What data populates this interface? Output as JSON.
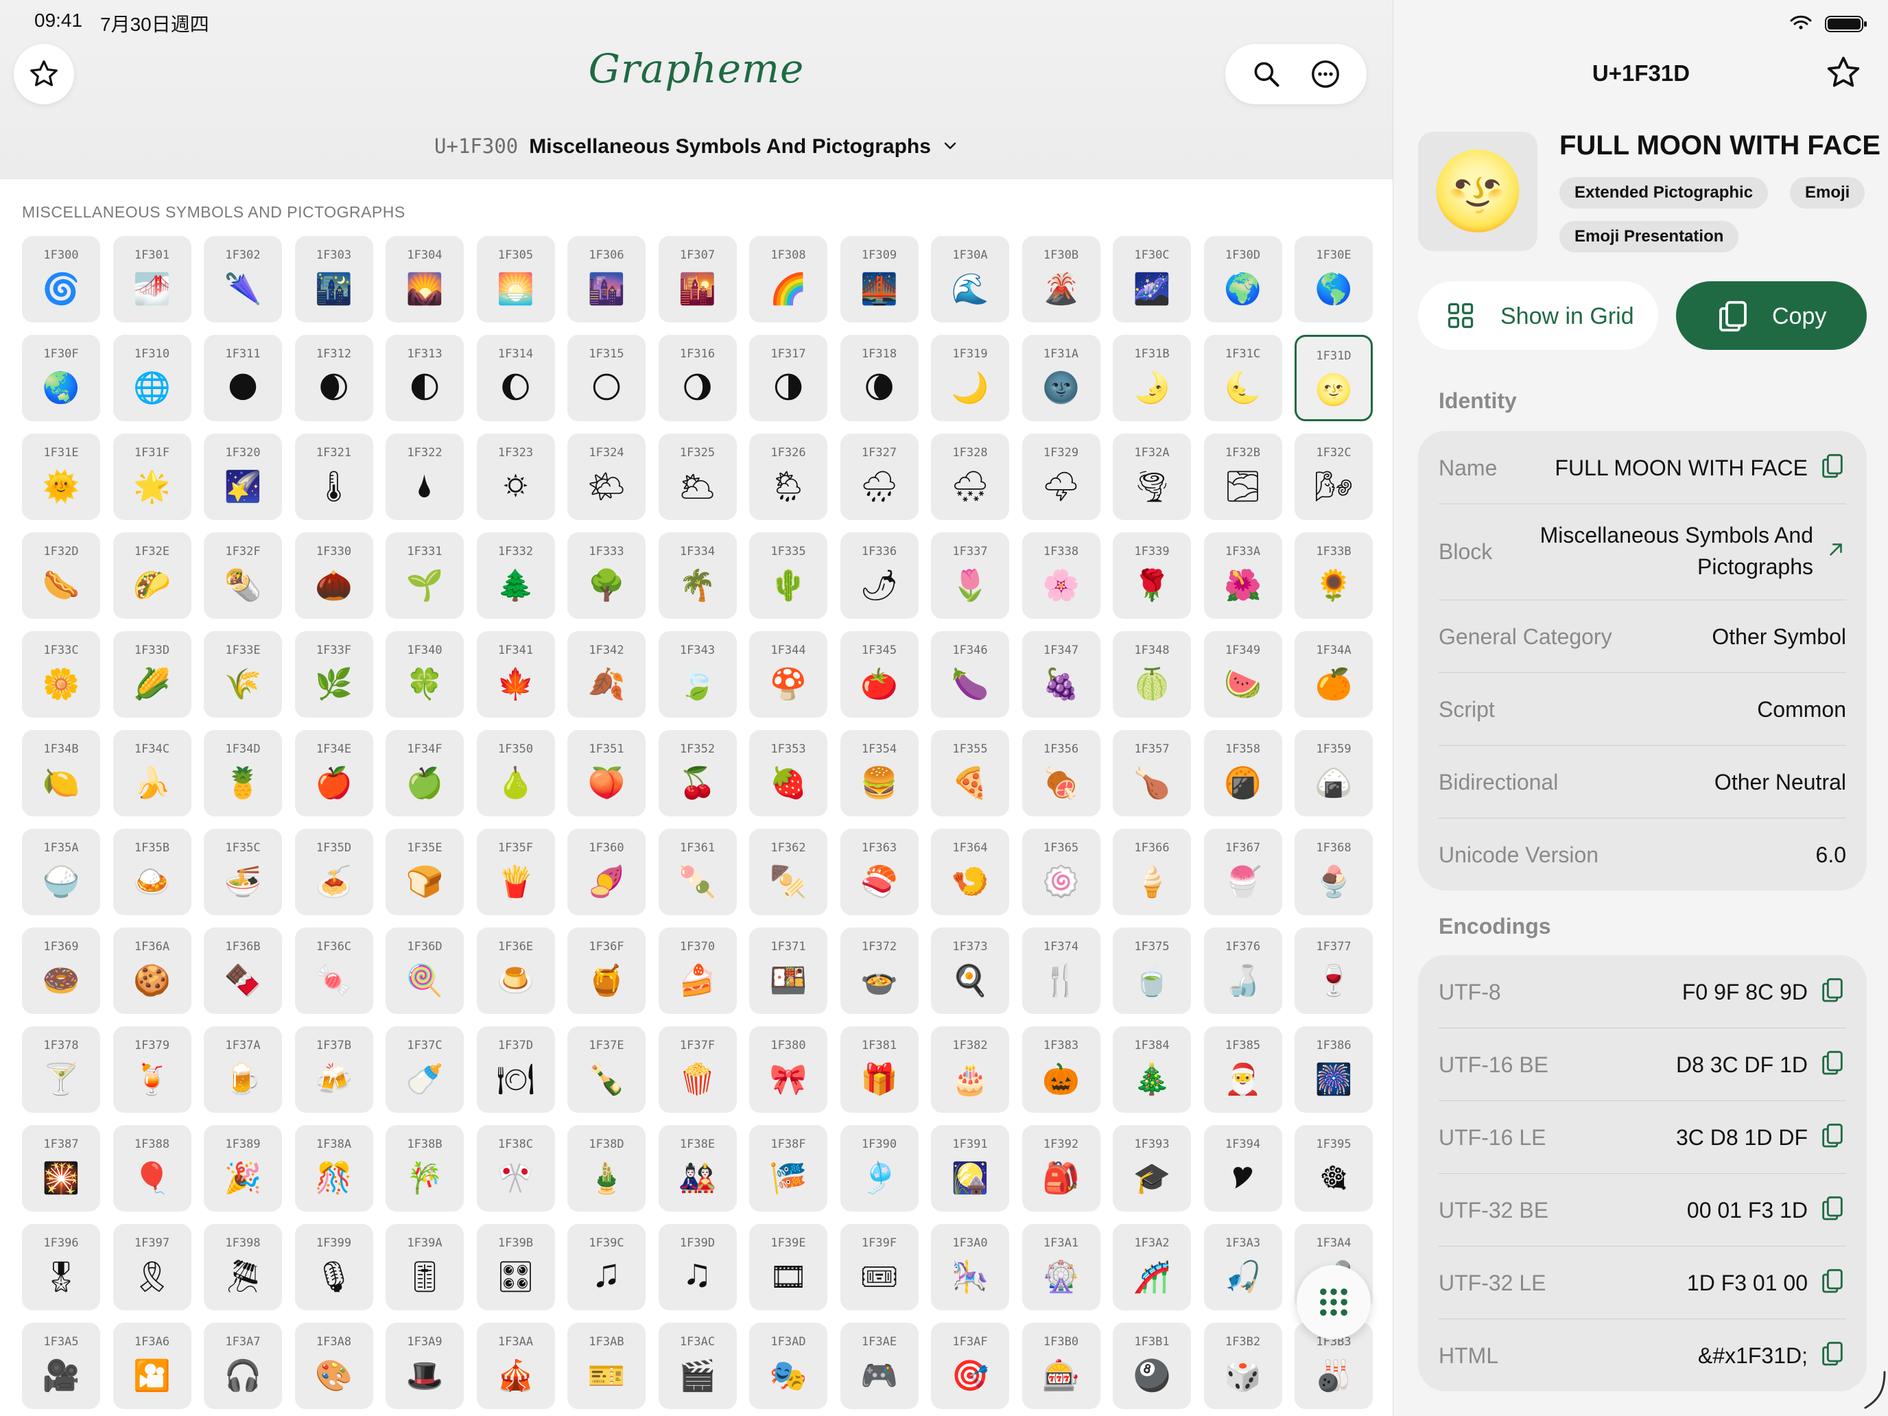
{
  "status": {
    "time": "09:41",
    "date": "7月30日週四"
  },
  "app": {
    "title": "Grapheme"
  },
  "block_picker": {
    "code": "U+1F300",
    "name": "Miscellaneous Symbols And Pictographs"
  },
  "section_header": "MISCELLANEOUS SYMBOLS AND PICTOGRAPHS",
  "grid_cells": [
    {
      "cp": "1F300",
      "g": "🌀"
    },
    {
      "cp": "1F301",
      "g": "🌁"
    },
    {
      "cp": "1F302",
      "g": "🌂"
    },
    {
      "cp": "1F303",
      "g": "🌃"
    },
    {
      "cp": "1F304",
      "g": "🌄"
    },
    {
      "cp": "1F305",
      "g": "🌅"
    },
    {
      "cp": "1F306",
      "g": "🌆"
    },
    {
      "cp": "1F307",
      "g": "🌇"
    },
    {
      "cp": "1F308",
      "g": "🌈"
    },
    {
      "cp": "1F309",
      "g": "🌉"
    },
    {
      "cp": "1F30A",
      "g": "🌊"
    },
    {
      "cp": "1F30B",
      "g": "🌋"
    },
    {
      "cp": "1F30C",
      "g": "🌌"
    },
    {
      "cp": "1F30D",
      "g": "🌍"
    },
    {
      "cp": "1F30E",
      "g": "🌎"
    },
    {
      "cp": "1F30F",
      "g": "🌏"
    },
    {
      "cp": "1F310",
      "g": "🌐"
    },
    {
      "cp": "1F311",
      "g": "🌑"
    },
    {
      "cp": "1F312",
      "g": "🌒"
    },
    {
      "cp": "1F313",
      "g": "🌓"
    },
    {
      "cp": "1F314",
      "g": "🌔"
    },
    {
      "cp": "1F315",
      "g": "🌕"
    },
    {
      "cp": "1F316",
      "g": "🌖"
    },
    {
      "cp": "1F317",
      "g": "🌗"
    },
    {
      "cp": "1F318",
      "g": "🌘"
    },
    {
      "cp": "1F319",
      "g": "🌙"
    },
    {
      "cp": "1F31A",
      "g": "🌚"
    },
    {
      "cp": "1F31B",
      "g": "🌛"
    },
    {
      "cp": "1F31C",
      "g": "🌜"
    },
    {
      "cp": "1F31D",
      "g": "🌝",
      "selected": true
    },
    {
      "cp": "1F31E",
      "g": "🌞"
    },
    {
      "cp": "1F31F",
      "g": "🌟"
    },
    {
      "cp": "1F320",
      "g": "🌠"
    },
    {
      "cp": "1F321",
      "g": "🌡"
    },
    {
      "cp": "1F322",
      "g": "🌢"
    },
    {
      "cp": "1F323",
      "g": "🌣"
    },
    {
      "cp": "1F324",
      "g": "🌤"
    },
    {
      "cp": "1F325",
      "g": "🌥"
    },
    {
      "cp": "1F326",
      "g": "🌦"
    },
    {
      "cp": "1F327",
      "g": "🌧"
    },
    {
      "cp": "1F328",
      "g": "🌨"
    },
    {
      "cp": "1F329",
      "g": "🌩"
    },
    {
      "cp": "1F32A",
      "g": "🌪"
    },
    {
      "cp": "1F32B",
      "g": "🌫"
    },
    {
      "cp": "1F32C",
      "g": "🌬"
    },
    {
      "cp": "1F32D",
      "g": "🌭"
    },
    {
      "cp": "1F32E",
      "g": "🌮"
    },
    {
      "cp": "1F32F",
      "g": "🌯"
    },
    {
      "cp": "1F330",
      "g": "🌰"
    },
    {
      "cp": "1F331",
      "g": "🌱"
    },
    {
      "cp": "1F332",
      "g": "🌲"
    },
    {
      "cp": "1F333",
      "g": "🌳"
    },
    {
      "cp": "1F334",
      "g": "🌴"
    },
    {
      "cp": "1F335",
      "g": "🌵"
    },
    {
      "cp": "1F336",
      "g": "🌶"
    },
    {
      "cp": "1F337",
      "g": "🌷"
    },
    {
      "cp": "1F338",
      "g": "🌸"
    },
    {
      "cp": "1F339",
      "g": "🌹"
    },
    {
      "cp": "1F33A",
      "g": "🌺"
    },
    {
      "cp": "1F33B",
      "g": "🌻"
    },
    {
      "cp": "1F33C",
      "g": "🌼"
    },
    {
      "cp": "1F33D",
      "g": "🌽"
    },
    {
      "cp": "1F33E",
      "g": "🌾"
    },
    {
      "cp": "1F33F",
      "g": "🌿"
    },
    {
      "cp": "1F340",
      "g": "🍀"
    },
    {
      "cp": "1F341",
      "g": "🍁"
    },
    {
      "cp": "1F342",
      "g": "🍂"
    },
    {
      "cp": "1F343",
      "g": "🍃"
    },
    {
      "cp": "1F344",
      "g": "🍄"
    },
    {
      "cp": "1F345",
      "g": "🍅"
    },
    {
      "cp": "1F346",
      "g": "🍆"
    },
    {
      "cp": "1F347",
      "g": "🍇"
    },
    {
      "cp": "1F348",
      "g": "🍈"
    },
    {
      "cp": "1F349",
      "g": "🍉"
    },
    {
      "cp": "1F34A",
      "g": "🍊"
    },
    {
      "cp": "1F34B",
      "g": "🍋"
    },
    {
      "cp": "1F34C",
      "g": "🍌"
    },
    {
      "cp": "1F34D",
      "g": "🍍"
    },
    {
      "cp": "1F34E",
      "g": "🍎"
    },
    {
      "cp": "1F34F",
      "g": "🍏"
    },
    {
      "cp": "1F350",
      "g": "🍐"
    },
    {
      "cp": "1F351",
      "g": "🍑"
    },
    {
      "cp": "1F352",
      "g": "🍒"
    },
    {
      "cp": "1F353",
      "g": "🍓"
    },
    {
      "cp": "1F354",
      "g": "🍔"
    },
    {
      "cp": "1F355",
      "g": "🍕"
    },
    {
      "cp": "1F356",
      "g": "🍖"
    },
    {
      "cp": "1F357",
      "g": "🍗"
    },
    {
      "cp": "1F358",
      "g": "🍘"
    },
    {
      "cp": "1F359",
      "g": "🍙"
    },
    {
      "cp": "1F35A",
      "g": "🍚"
    },
    {
      "cp": "1F35B",
      "g": "🍛"
    },
    {
      "cp": "1F35C",
      "g": "🍜"
    },
    {
      "cp": "1F35D",
      "g": "🍝"
    },
    {
      "cp": "1F35E",
      "g": "🍞"
    },
    {
      "cp": "1F35F",
      "g": "🍟"
    },
    {
      "cp": "1F360",
      "g": "🍠"
    },
    {
      "cp": "1F361",
      "g": "🍡"
    },
    {
      "cp": "1F362",
      "g": "🍢"
    },
    {
      "cp": "1F363",
      "g": "🍣"
    },
    {
      "cp": "1F364",
      "g": "🍤"
    },
    {
      "cp": "1F365",
      "g": "🍥"
    },
    {
      "cp": "1F366",
      "g": "🍦"
    },
    {
      "cp": "1F367",
      "g": "🍧"
    },
    {
      "cp": "1F368",
      "g": "🍨"
    },
    {
      "cp": "1F369",
      "g": "🍩"
    },
    {
      "cp": "1F36A",
      "g": "🍪"
    },
    {
      "cp": "1F36B",
      "g": "🍫"
    },
    {
      "cp": "1F36C",
      "g": "🍬"
    },
    {
      "cp": "1F36D",
      "g": "🍭"
    },
    {
      "cp": "1F36E",
      "g": "🍮"
    },
    {
      "cp": "1F36F",
      "g": "🍯"
    },
    {
      "cp": "1F370",
      "g": "🍰"
    },
    {
      "cp": "1F371",
      "g": "🍱"
    },
    {
      "cp": "1F372",
      "g": "🍲"
    },
    {
      "cp": "1F373",
      "g": "🍳"
    },
    {
      "cp": "1F374",
      "g": "🍴"
    },
    {
      "cp": "1F375",
      "g": "🍵"
    },
    {
      "cp": "1F376",
      "g": "🍶"
    },
    {
      "cp": "1F377",
      "g": "🍷"
    },
    {
      "cp": "1F378",
      "g": "🍸"
    },
    {
      "cp": "1F379",
      "g": "🍹"
    },
    {
      "cp": "1F37A",
      "g": "🍺"
    },
    {
      "cp": "1F37B",
      "g": "🍻"
    },
    {
      "cp": "1F37C",
      "g": "🍼"
    },
    {
      "cp": "1F37D",
      "g": "🍽"
    },
    {
      "cp": "1F37E",
      "g": "🍾"
    },
    {
      "cp": "1F37F",
      "g": "🍿"
    },
    {
      "cp": "1F380",
      "g": "🎀"
    },
    {
      "cp": "1F381",
      "g": "🎁"
    },
    {
      "cp": "1F382",
      "g": "🎂"
    },
    {
      "cp": "1F383",
      "g": "🎃"
    },
    {
      "cp": "1F384",
      "g": "🎄"
    },
    {
      "cp": "1F385",
      "g": "🎅"
    },
    {
      "cp": "1F386",
      "g": "🎆"
    },
    {
      "cp": "1F387",
      "g": "🎇"
    },
    {
      "cp": "1F388",
      "g": "🎈"
    },
    {
      "cp": "1F389",
      "g": "🎉"
    },
    {
      "cp": "1F38A",
      "g": "🎊"
    },
    {
      "cp": "1F38B",
      "g": "🎋"
    },
    {
      "cp": "1F38C",
      "g": "🎌"
    },
    {
      "cp": "1F38D",
      "g": "🎍"
    },
    {
      "cp": "1F38E",
      "g": "🎎"
    },
    {
      "cp": "1F38F",
      "g": "🎏"
    },
    {
      "cp": "1F390",
      "g": "🎐"
    },
    {
      "cp": "1F391",
      "g": "🎑"
    },
    {
      "cp": "1F392",
      "g": "🎒"
    },
    {
      "cp": "1F393",
      "g": "🎓"
    },
    {
      "cp": "1F394",
      "g": "🎔"
    },
    {
      "cp": "1F395",
      "g": "🎕"
    },
    {
      "cp": "1F396",
      "g": "🎖"
    },
    {
      "cp": "1F397",
      "g": "🎗"
    },
    {
      "cp": "1F398",
      "g": "🎘"
    },
    {
      "cp": "1F399",
      "g": "🎙"
    },
    {
      "cp": "1F39A",
      "g": "🎚"
    },
    {
      "cp": "1F39B",
      "g": "🎛"
    },
    {
      "cp": "1F39C",
      "g": "🎜"
    },
    {
      "cp": "1F39D",
      "g": "🎝"
    },
    {
      "cp": "1F39E",
      "g": "🎞"
    },
    {
      "cp": "1F39F",
      "g": "🎟"
    },
    {
      "cp": "1F3A0",
      "g": "🎠"
    },
    {
      "cp": "1F3A1",
      "g": "🎡"
    },
    {
      "cp": "1F3A2",
      "g": "🎢"
    },
    {
      "cp": "1F3A3",
      "g": "🎣"
    },
    {
      "cp": "1F3A4",
      "g": "🎤"
    },
    {
      "cp": "1F3A5",
      "g": "🎥"
    },
    {
      "cp": "1F3A6",
      "g": "🎦"
    },
    {
      "cp": "1F3A7",
      "g": "🎧"
    },
    {
      "cp": "1F3A8",
      "g": "🎨"
    },
    {
      "cp": "1F3A9",
      "g": "🎩"
    },
    {
      "cp": "1F3AA",
      "g": "🎪"
    },
    {
      "cp": "1F3AB",
      "g": "🎫"
    },
    {
      "cp": "1F3AC",
      "g": "🎬"
    },
    {
      "cp": "1F3AD",
      "g": "🎭"
    },
    {
      "cp": "1F3AE",
      "g": "🎮"
    },
    {
      "cp": "1F3AF",
      "g": "🎯"
    },
    {
      "cp": "1F3B0",
      "g": "🎰"
    },
    {
      "cp": "1F3B1",
      "g": "🎱"
    },
    {
      "cp": "1F3B2",
      "g": "🎲"
    },
    {
      "cp": "1F3B3",
      "g": "🎳"
    }
  ],
  "detail": {
    "codepoint": "U+1F31D",
    "glyph": "🌝",
    "name": "FULL MOON WITH FACE",
    "tags": [
      "Extended Pictographic",
      "Emoji",
      "Emoji Presentation"
    ],
    "show_in_grid_label": "Show in Grid",
    "copy_label": "Copy",
    "identity_title": "Identity",
    "identity": {
      "name_label": "Name",
      "name_value": "FULL MOON WITH FACE",
      "block_label": "Block",
      "block_value_line1": "Miscellaneous Symbols And",
      "block_value_line2": "Pictographs",
      "category_label": "General Category",
      "category_value": "Other Symbol",
      "script_label": "Script",
      "script_value": "Common",
      "bidi_label": "Bidirectional",
      "bidi_value": "Other Neutral",
      "version_label": "Unicode Version",
      "version_value": "6.0"
    },
    "encodings_title": "Encodings",
    "encodings": [
      {
        "label": "UTF-8",
        "value": "F0 9F 8C 9D"
      },
      {
        "label": "UTF-16 BE",
        "value": "D8 3C DF 1D"
      },
      {
        "label": "UTF-16 LE",
        "value": "3C D8 1D DF"
      },
      {
        "label": "UTF-32 BE",
        "value": "00 01 F3 1D"
      },
      {
        "label": "UTF-32 LE",
        "value": "1D F3 01 00"
      },
      {
        "label": "HTML",
        "value": "&#x1F31D;"
      }
    ]
  },
  "colors": {
    "accent": "#1f6a43",
    "cell_bg": "#ececec",
    "panel_bg": "#f4f4f4"
  },
  "icons": [
    "star-icon",
    "search-icon",
    "more-icon",
    "chevron-down-icon",
    "grid-icon",
    "copy-icon",
    "external-link-icon",
    "wifi-icon",
    "battery-icon",
    "dots-grid-icon"
  ]
}
